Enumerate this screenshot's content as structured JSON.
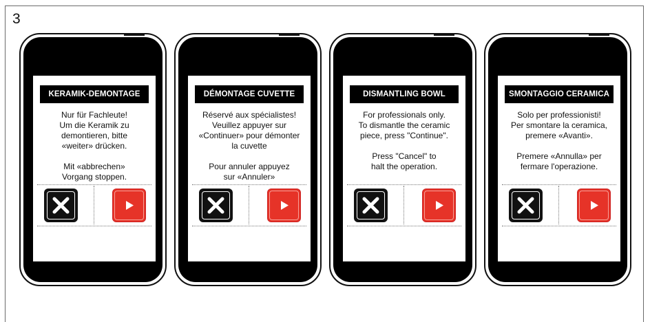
{
  "step_number": "3",
  "colors": {
    "title_bar": "#000000",
    "continue_button": "#e63328",
    "cancel_button": "#111111"
  },
  "icons": {
    "cancel": "close-x-icon",
    "continue": "play-triangle-icon"
  },
  "phones": [
    {
      "title": "KERAMIK-DEMONTAGE",
      "message": "Nur für Fachleute!\nUm die Keramik zu\ndemontieren, bitte\n«weiter» drücken.\n\nMit «abbrechen»\nVorgang stoppen."
    },
    {
      "title": "DÉMONTAGE CUVETTE",
      "message": "Réservé aux spécialistes!\nVeuillez appuyer sur\n«Continuer» pour démonter\nla cuvette\n\nPour annuler appuyez\nsur «Annuler»"
    },
    {
      "title": "DISMANTLING BOWL",
      "message": "For professionals only.\nTo dismantle the ceramic\npiece, press \"Continue\".\n\nPress \"Cancel\" to\nhalt the operation."
    },
    {
      "title": "SMONTAGGIO CERAMICA",
      "message": "Solo per professionisti!\nPer smontare la ceramica,\npremere «Avanti».\n\nPremere «Annulla» per\nfermare l'operazione."
    }
  ]
}
